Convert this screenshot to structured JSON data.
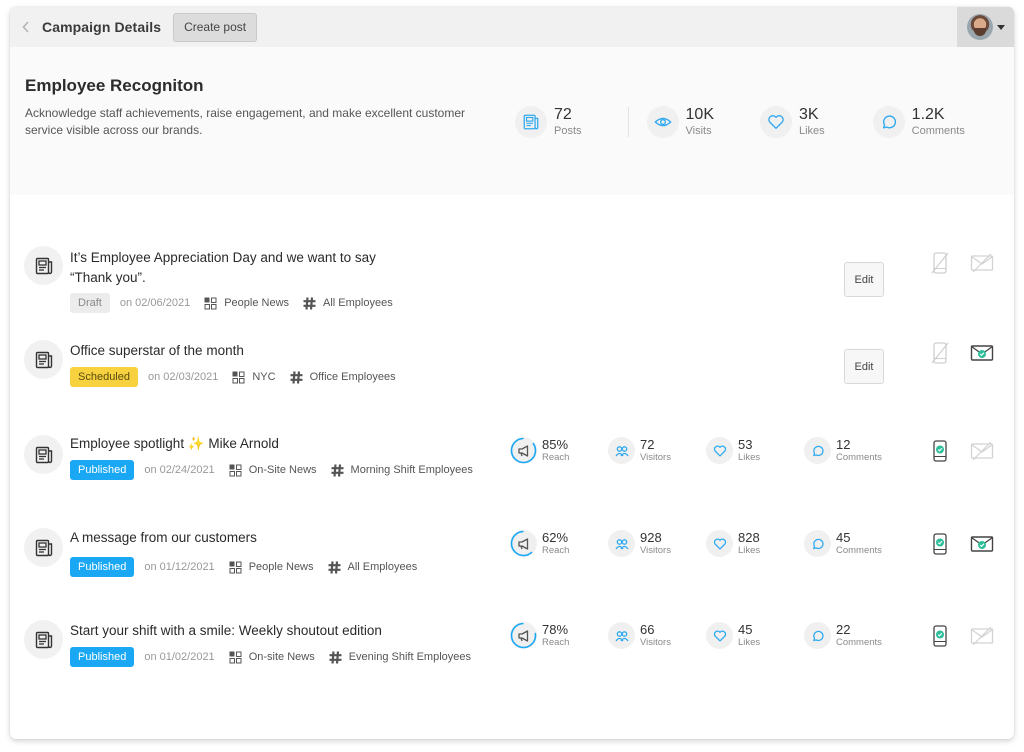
{
  "topbar": {
    "title": "Campaign Details",
    "create_post_label": "Create post",
    "back_icon": "chevron-left-icon",
    "profile_caret_icon": "caret-down-icon"
  },
  "campaign": {
    "title": "Employee Recogniton",
    "description": "Acknowledge staff achievements, raise engagement, and make excellent customer service visible across our brands.",
    "stats": [
      {
        "value": "72",
        "label": "Posts",
        "icon": "newspaper-icon"
      },
      {
        "value": "10K",
        "label": "Visits",
        "icon": "eye-icon"
      },
      {
        "value": "3K",
        "label": "Likes",
        "icon": "heart-icon"
      },
      {
        "value": "1.2K",
        "label": "Comments",
        "icon": "comment-icon"
      }
    ]
  },
  "colors": {
    "accent": "#1aa8f5",
    "icon_blue": "#2fa9f0",
    "scheduled": "#f7d23e",
    "draft": "#ececec",
    "check_green": "#2ebf9a"
  },
  "posts": [
    {
      "title_line1": "It’s Employee Appreciation Day and we want to say",
      "title_line2": "“Thank you”.",
      "status": "Draft",
      "date": "on 02/06/2021",
      "category": "People News",
      "audience": "All Employees",
      "edit_label": "Edit",
      "mobile_sent": false,
      "email_sent": false
    },
    {
      "title_line1": "Office superstar of the month",
      "status": "Scheduled",
      "date": "on 02/03/2021",
      "category": "NYC",
      "audience": "Office Employees",
      "edit_label": "Edit",
      "mobile_sent": false,
      "email_sent": true
    },
    {
      "title_line1": "Employee spotlight ✨ Mike Arnold",
      "status": "Published",
      "date": "on 02/24/2021",
      "category": "On-Site News",
      "audience": "Morning Shift Employees",
      "reach": "85%",
      "reach_label": "Reach",
      "reach_fraction": 0.85,
      "visitors": "72",
      "visitors_label": "Visitors",
      "likes": "53",
      "likes_label": "Likes",
      "comments": "12",
      "comments_label": "Comments",
      "mobile_sent": true,
      "email_sent": false
    },
    {
      "title_line1": "A message from our customers",
      "status": "Published",
      "date": "on 01/12/2021",
      "category": "People News",
      "audience": "All Employees",
      "reach": "62%",
      "reach_label": "Reach",
      "reach_fraction": 0.62,
      "visitors": "928",
      "visitors_label": "Visitors",
      "likes": "828",
      "likes_label": "Likes",
      "comments": "45",
      "comments_label": "Comments",
      "mobile_sent": true,
      "email_sent": true
    },
    {
      "title_line1": "Start your shift with a smile: Weekly shoutout edition",
      "status": "Published",
      "date": "on 01/02/2021",
      "category": "On-site News",
      "audience": "Evening Shift Employees",
      "reach": "78%",
      "reach_label": "Reach",
      "reach_fraction": 0.78,
      "visitors": "66",
      "visitors_label": "Visitors",
      "likes": "45",
      "likes_label": "Likes",
      "comments": "22",
      "comments_label": "Comments",
      "mobile_sent": true,
      "email_sent": false
    }
  ]
}
